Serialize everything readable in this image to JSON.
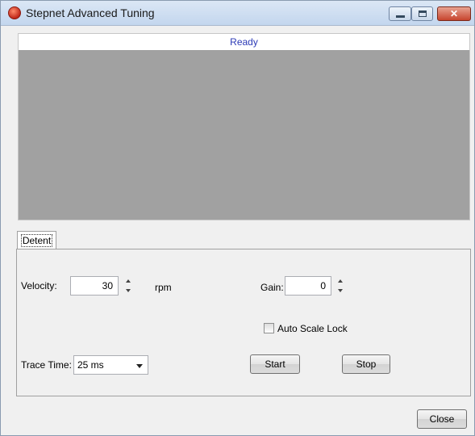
{
  "window": {
    "title": "Stepnet Advanced Tuning"
  },
  "trace": {
    "status": "Ready"
  },
  "tabs": [
    {
      "label": "Detent"
    }
  ],
  "detent": {
    "velocity_label": "Velocity:",
    "velocity_value": "30",
    "velocity_unit": "rpm",
    "gain_label": "Gain:",
    "gain_value": "0",
    "auto_scale_label": "Auto Scale Lock",
    "auto_scale_checked": false,
    "trace_time_label": "Trace Time:",
    "trace_time_value": "25 ms",
    "start_label": "Start",
    "stop_label": "Stop"
  },
  "footer": {
    "close_label": "Close"
  },
  "icons": {
    "app": "stepnet-app-icon",
    "minimize": "minimize-icon",
    "maximize": "maximize-icon",
    "close": "close-icon"
  },
  "colors": {
    "status_text": "#2c3ab6",
    "trace_background": "#a1a1a1"
  }
}
